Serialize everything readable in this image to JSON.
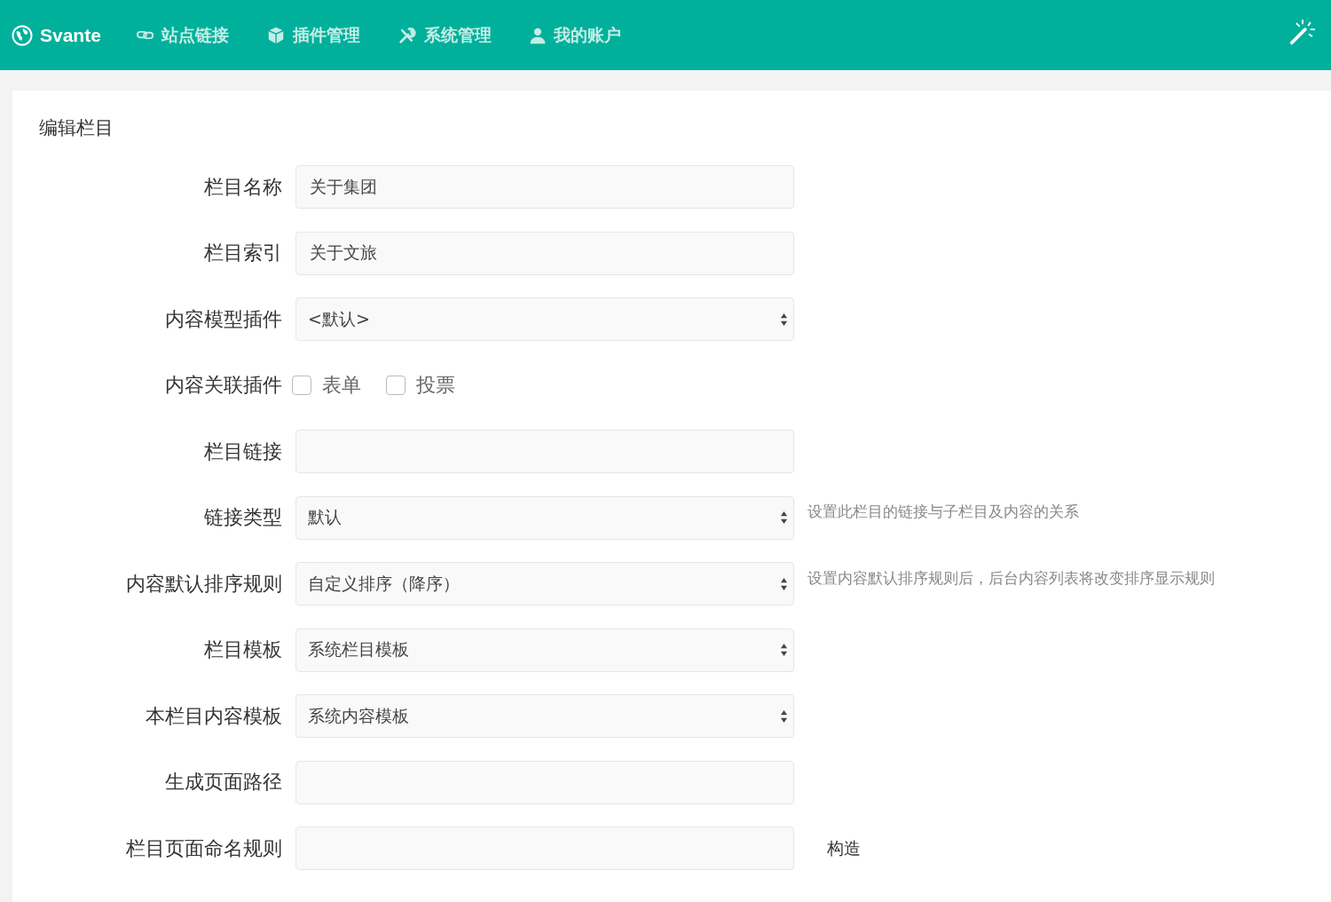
{
  "navbar": {
    "brand": "Svante",
    "items": [
      {
        "label": "站点链接",
        "kind": "link"
      },
      {
        "label": "插件管理",
        "kind": "plugin"
      },
      {
        "label": "系统管理",
        "kind": "system"
      },
      {
        "label": "我的账户",
        "kind": "account"
      }
    ]
  },
  "card": {
    "title": "编辑栏目",
    "rows": [
      {
        "kind": "input",
        "label": "栏目名称",
        "value": "关于集团"
      },
      {
        "kind": "input",
        "label": "栏目索引",
        "value": "关于文旅"
      },
      {
        "kind": "select",
        "label": "内容模型插件",
        "value": "<默认>"
      },
      {
        "kind": "checkboxes",
        "label": "内容关联插件",
        "options": [
          {
            "label": "表单",
            "checked": false
          },
          {
            "label": "投票",
            "checked": false
          }
        ]
      },
      {
        "kind": "input",
        "label": "栏目链接"
      },
      {
        "kind": "select",
        "label": "链接类型",
        "value": "默认",
        "hint": "设置此栏目的链接与子栏目及内容的关系"
      },
      {
        "kind": "select",
        "label": "内容默认排序规则",
        "value": "自定义排序（降序）",
        "hint": "设置内容默认排序规则后，后台内容列表将改变排序显示规则"
      },
      {
        "kind": "select",
        "label": "栏目模板",
        "value": "系统栏目模板"
      },
      {
        "kind": "select",
        "label": "本栏目内容模板",
        "value": "系统内容模板"
      },
      {
        "kind": "input",
        "label": "生成页面路径"
      },
      {
        "kind": "input",
        "label": "栏目页面命名规则",
        "action": "构造"
      }
    ]
  }
}
